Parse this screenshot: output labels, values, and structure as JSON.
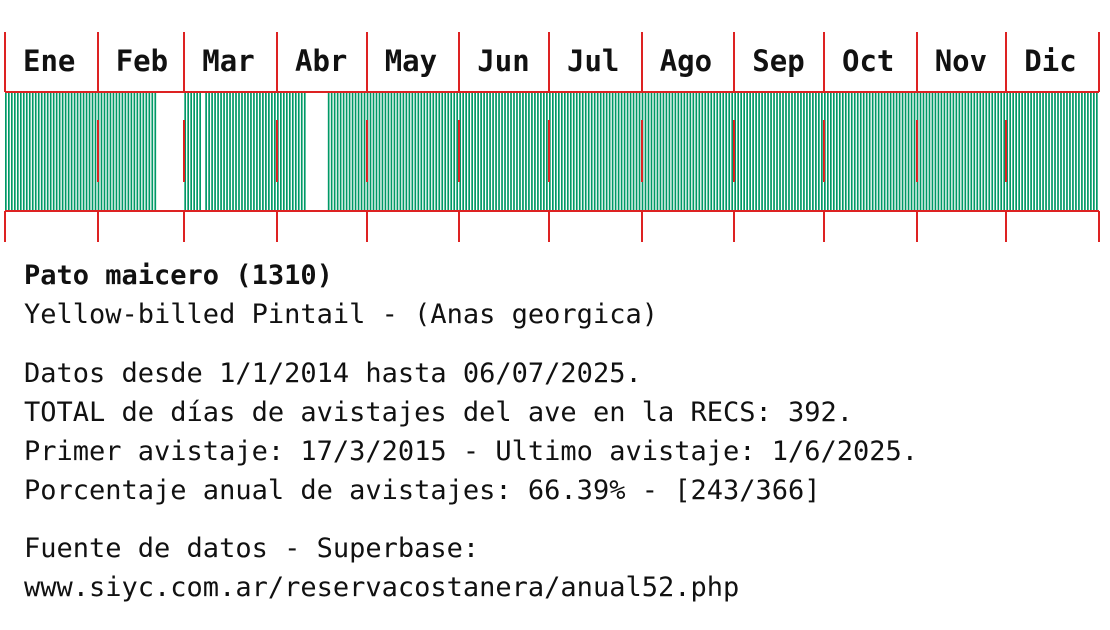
{
  "chart_data": {
    "type": "heatmap",
    "description_months": [
      "Ene",
      "Feb",
      "Mar",
      "Abr",
      "May",
      "Jun",
      "Jul",
      "Ago",
      "Sep",
      "Oct",
      "Nov",
      "Dic"
    ],
    "month_days": [
      31,
      29,
      31,
      30,
      31,
      30,
      31,
      31,
      30,
      31,
      30,
      31
    ],
    "presence_color": "#009966",
    "border_color": "#dd2222",
    "sighting_days": [
      [
        1,
        2,
        3,
        4,
        5,
        6,
        7,
        8,
        9,
        10,
        11,
        12,
        13,
        14,
        15,
        16,
        17,
        18,
        19,
        20,
        21,
        22,
        23,
        24,
        25,
        26,
        27,
        28,
        29,
        30,
        31
      ],
      [
        1,
        2,
        3,
        4,
        5,
        6,
        7,
        8,
        9,
        10,
        11,
        12,
        13,
        14,
        15,
        16,
        17,
        18,
        19,
        20
      ],
      [
        1,
        2,
        3,
        4,
        5,
        6,
        8,
        9,
        10,
        11,
        12,
        13,
        14,
        15,
        16,
        17,
        18,
        19,
        20,
        21,
        22,
        23,
        24,
        25,
        26,
        27,
        28,
        29,
        30,
        31
      ],
      [
        1,
        2,
        3,
        4,
        5,
        6,
        7,
        8,
        9,
        10,
        18,
        19,
        20,
        21,
        22,
        23,
        24,
        25,
        26,
        27,
        28,
        29,
        30
      ],
      [
        1,
        2,
        3,
        4,
        5,
        6,
        7,
        8,
        9,
        10,
        11,
        12,
        13,
        14,
        15,
        16,
        17,
        18,
        19,
        20,
        21,
        22,
        23,
        24,
        25,
        26,
        27,
        28,
        29,
        30,
        31
      ],
      [
        1,
        2,
        3,
        4,
        5,
        6,
        7,
        8,
        9,
        10,
        11,
        12,
        13,
        14,
        15,
        16,
        17,
        18,
        19,
        20,
        21,
        22,
        23,
        24,
        25,
        26,
        27,
        28,
        29,
        30
      ],
      [
        1,
        2,
        3,
        4,
        5,
        6,
        7,
        8,
        9,
        10,
        11,
        12,
        13,
        14,
        15,
        16,
        17,
        18,
        19,
        20,
        21,
        22,
        23,
        24,
        25,
        26,
        27,
        28,
        29,
        30,
        31
      ],
      [
        1,
        2,
        3,
        4,
        5,
        6,
        7,
        8,
        9,
        10,
        11,
        12,
        13,
        14,
        15,
        16,
        17,
        18,
        19,
        20,
        21,
        22,
        23,
        24,
        25,
        26,
        27,
        28,
        29,
        30,
        31
      ],
      [
        1,
        2,
        3,
        4,
        5,
        6,
        7,
        8,
        9,
        10,
        11,
        12,
        13,
        14,
        15,
        16,
        17,
        18,
        19,
        20,
        21,
        22,
        23,
        24,
        25,
        26,
        27,
        28,
        29,
        30
      ],
      [
        1,
        2,
        3,
        4,
        5,
        6,
        7,
        8,
        9,
        10,
        11,
        12,
        13,
        14,
        15,
        16,
        17,
        18,
        19,
        20,
        21,
        22,
        23,
        24,
        25,
        26,
        27,
        28,
        29,
        30,
        31
      ],
      [
        1,
        2,
        3,
        4,
        5,
        6,
        7,
        8,
        9,
        10,
        11,
        12,
        13,
        14,
        15,
        16,
        17,
        18,
        19,
        20,
        21,
        22,
        23,
        24,
        25,
        26,
        27,
        28,
        29,
        30
      ],
      [
        1,
        2,
        3,
        4,
        5,
        6,
        7,
        8,
        9,
        10,
        11,
        12,
        13,
        14,
        15,
        16,
        17,
        18,
        19,
        20,
        21,
        22,
        23,
        24,
        25,
        26,
        27,
        28,
        29,
        30,
        31
      ]
    ]
  },
  "info": {
    "title": "Pato maicero (1310)",
    "subtitle": "Yellow-billed Pintail - (Anas georgica)",
    "range": "Datos desde 1/1/2014 hasta 06/07/2025.",
    "total": "TOTAL de días de avistajes del ave en la RECS: 392.",
    "first_last": "Primer avistaje: 17/3/2015 - Ultimo avistaje: 1/6/2025.",
    "percent": "Porcentaje anual de avistajes: 66.39% - [243/366]",
    "source_label": "Fuente de datos - Superbase:",
    "source_url": "www.siyc.com.ar/reservacostanera/anual52.php"
  }
}
